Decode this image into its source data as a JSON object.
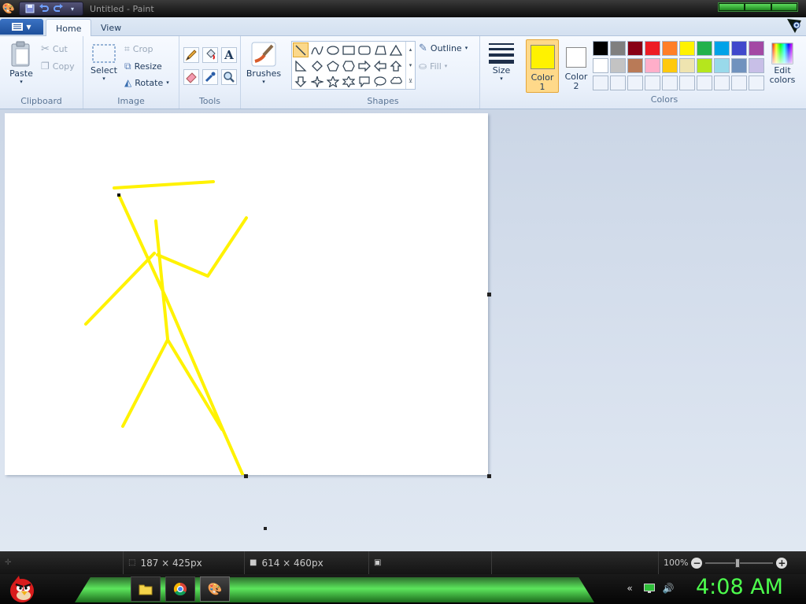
{
  "window": {
    "title": "Untitled - Paint"
  },
  "tabs": {
    "home": "Home",
    "view": "View"
  },
  "clipboard": {
    "paste": "Paste",
    "cut": "Cut",
    "copy": "Copy",
    "group": "Clipboard"
  },
  "image": {
    "select": "Select",
    "crop": "Crop",
    "resize": "Resize",
    "rotate": "Rotate",
    "group": "Image"
  },
  "tools": {
    "group": "Tools"
  },
  "brushes": {
    "label": "Brushes"
  },
  "shapes": {
    "outline": "Outline",
    "fill": "Fill",
    "group": "Shapes"
  },
  "size": {
    "label": "Size"
  },
  "colors": {
    "color1_line1": "Color",
    "color1_line2": "1",
    "color2_line1": "Color",
    "color2_line2": "2",
    "edit_line1": "Edit",
    "edit_line2": "colors",
    "group": "Colors",
    "active_color": "#fff200",
    "palette_row1": [
      "#000000",
      "#7f7f7f",
      "#880015",
      "#ed1c24",
      "#ff7f27",
      "#fff200",
      "#22b14c",
      "#00a2e8",
      "#3f48cc",
      "#a349a4"
    ],
    "palette_row2": [
      "#ffffff",
      "#c3c3c3",
      "#b97a57",
      "#ffaec9",
      "#ffc90e",
      "#efe4b0",
      "#b5e61d",
      "#99d9ea",
      "#7092be",
      "#c8bfe7"
    ]
  },
  "status": {
    "cursor_pos": "187 × 425px",
    "canvas_size": "614 × 460px",
    "zoom": "100%"
  },
  "taskbar": {
    "clock": "4:08 AM"
  }
}
